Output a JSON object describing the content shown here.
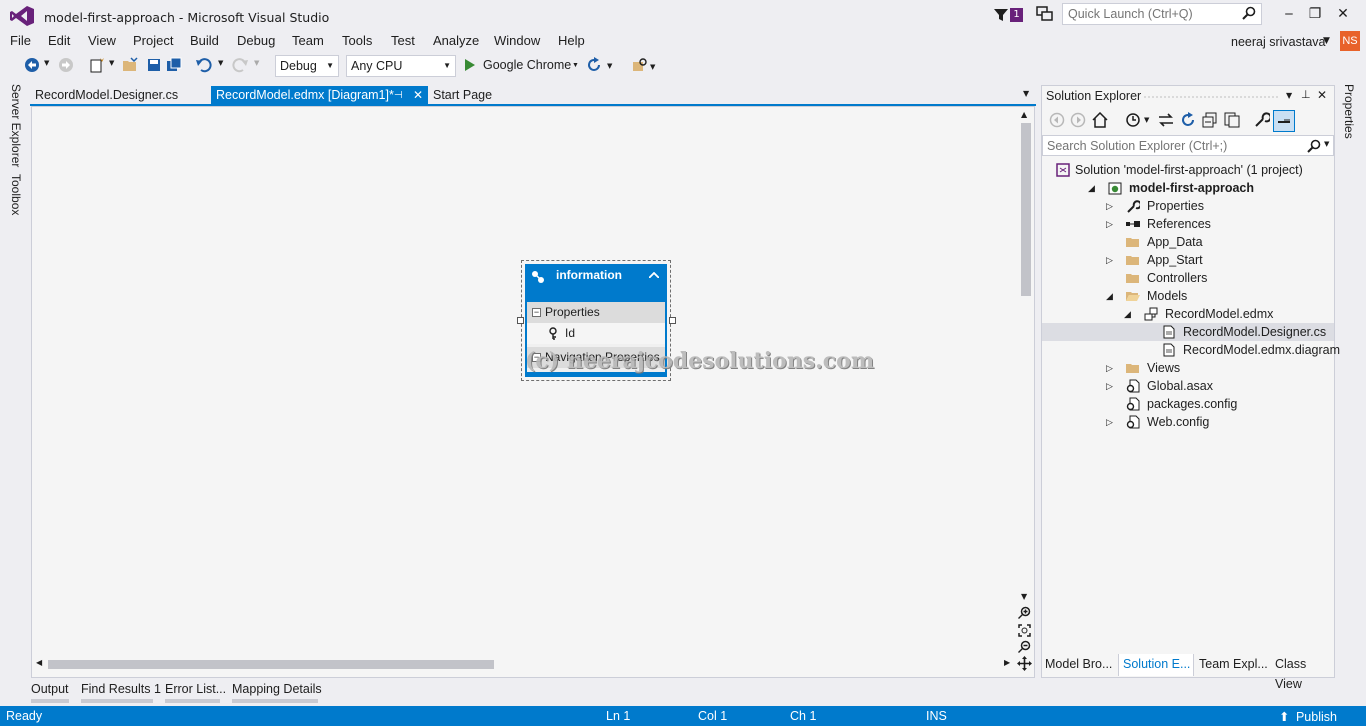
{
  "window": {
    "title": "model-first-approach - Microsoft Visual Studio",
    "notification_count": "1",
    "quick_launch_placeholder": "Quick Launch (Ctrl+Q)",
    "minimize": "‒",
    "restore": "❐",
    "close": "✕"
  },
  "menu": [
    "File",
    "Edit",
    "View",
    "Project",
    "Build",
    "Debug",
    "Team",
    "Tools",
    "Test",
    "Analyze",
    "Window",
    "Help"
  ],
  "user": {
    "name": "neeraj srivastava",
    "initials": "NS"
  },
  "toolbar": {
    "configuration": "Debug",
    "platform": "Any CPU",
    "run_target": "Google Chrome"
  },
  "side_tabs": {
    "server_explorer": "Server Explorer",
    "toolbox": "Toolbox",
    "properties": "Properties"
  },
  "doc_tabs": [
    {
      "label": "RecordModel.Designer.cs"
    },
    {
      "label": "RecordModel.edmx [Diagram1]*",
      "active": true
    },
    {
      "label": "Start Page"
    }
  ],
  "entity": {
    "name": "information",
    "properties_label": "Properties",
    "property": "Id",
    "nav_label": "Navigation Properties"
  },
  "watermark": "(c) neerajcodesolutions.com",
  "bottom_tabs": [
    "Output",
    "Find Results 1",
    "Error List...",
    "Mapping Details"
  ],
  "status": {
    "ready": "Ready",
    "ln": "Ln 1",
    "col": "Col 1",
    "ch": "Ch 1",
    "mode": "INS",
    "publish": "Publish"
  },
  "solution_explorer": {
    "title": "Solution Explorer",
    "search_placeholder": "Search Solution Explorer (Ctrl+;)",
    "tree": [
      {
        "label": "Solution 'model-first-approach' (1 project)",
        "icon": "solution-icon",
        "twisty": ""
      },
      {
        "label": "model-first-approach",
        "icon": "web-project-icon",
        "twisty": "◢",
        "bold": true
      },
      {
        "label": "Properties",
        "icon": "wrench-icon",
        "twisty": "▷"
      },
      {
        "label": "References",
        "icon": "references-icon",
        "twisty": "▷"
      },
      {
        "label": "App_Data",
        "icon": "folder-icon",
        "twisty": ""
      },
      {
        "label": "App_Start",
        "icon": "folder-icon",
        "twisty": "▷"
      },
      {
        "label": "Controllers",
        "icon": "folder-icon",
        "twisty": ""
      },
      {
        "label": "Models",
        "icon": "folder-open-icon",
        "twisty": "◢"
      },
      {
        "label": "RecordModel.edmx",
        "icon": "edmx-icon",
        "twisty": "◢"
      },
      {
        "label": "RecordModel.Designer.cs",
        "icon": "file-icon",
        "twisty": "",
        "selected": true
      },
      {
        "label": "RecordModel.edmx.diagram",
        "icon": "file-icon",
        "twisty": ""
      },
      {
        "label": "Views",
        "icon": "folder-icon",
        "twisty": "▷"
      },
      {
        "label": "Global.asax",
        "icon": "file-gear-icon",
        "twisty": "▷"
      },
      {
        "label": "packages.config",
        "icon": "file-gear-icon",
        "twisty": ""
      },
      {
        "label": "Web.config",
        "icon": "file-gear-icon",
        "twisty": "▷"
      }
    ],
    "tabs": [
      "Model Bro...",
      "Solution E...",
      "Team Expl...",
      "Class View"
    ]
  }
}
